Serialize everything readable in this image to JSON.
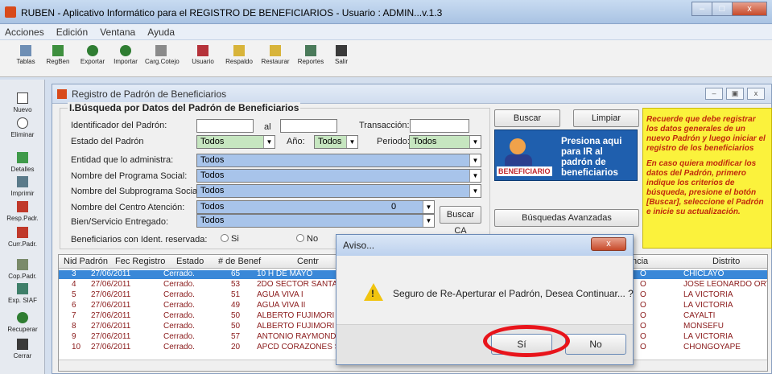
{
  "window": {
    "title": "RUBEN - Aplicativo Informático para el REGISTRO DE BENEFICIARIOS    - Usuario : ADMIN...v.1.3"
  },
  "menu": [
    "Acciones",
    "Edición",
    "Ventana",
    "Ayuda"
  ],
  "toolbar": [
    {
      "label": "Tablas",
      "icon": "table-icon"
    },
    {
      "label": "RegBen",
      "icon": "register-icon"
    },
    {
      "label": "Exportar",
      "icon": "export-icon"
    },
    {
      "label": "Importar",
      "icon": "import-icon"
    },
    {
      "label": "Carg.Cotejo",
      "icon": "compare-icon"
    },
    {
      "label": "Usuario",
      "icon": "user-icon"
    },
    {
      "label": "Respaldo",
      "icon": "backup-icon"
    },
    {
      "label": "Restaurar",
      "icon": "restore-icon"
    },
    {
      "label": "Reportes",
      "icon": "report-icon"
    },
    {
      "label": "Salir",
      "icon": "exit-icon"
    }
  ],
  "sidebar": [
    {
      "label": "Nuevo",
      "icon": "new-icon"
    },
    {
      "label": "Eliminar",
      "icon": "delete-icon"
    },
    {
      "label": "Detalles",
      "icon": "details-icon"
    },
    {
      "label": "Imprimir",
      "icon": "print-icon"
    },
    {
      "label": "Resp.Padr.",
      "icon": "arrow-left-icon"
    },
    {
      "label": "Curr.Padr.",
      "icon": "arrow-right-icon"
    },
    {
      "label": "Cop.Padr.",
      "icon": "copy-icon"
    },
    {
      "label": "Exp. SIAF",
      "icon": "export-siaf-icon"
    },
    {
      "label": "Recuperar",
      "icon": "recover-icon"
    },
    {
      "label": "Cerrar",
      "icon": "close-door-icon"
    }
  ],
  "child": {
    "title": "Registro de Padrón de Beneficiarios",
    "group_title": "I.Búsqueda por Datos del Padrón de Beneficiarios",
    "labels": {
      "id": "Identificador del Padrón:",
      "al": "al",
      "transaccion": "Transacción:",
      "estado": "Estado del Padrón",
      "anio": "Año:",
      "periodo": "Periodo:",
      "entidad": "Entidad que lo administra:",
      "programa": "Nombre del Programa Social:",
      "subprograma": "Nombre del Subprograma Social:",
      "centro": "Nombre del Centro Atención:",
      "bien": "Bien/Servicio Entregado:",
      "reservada": "Beneficiarios con Ident. reservada:"
    },
    "values": {
      "estado": "Todos",
      "anio": "Todos",
      "periodo": "Todos",
      "entidad": "Todos",
      "programa": "Todos",
      "subprograma": "Todos",
      "centro": "Todos",
      "centro_num": "0",
      "bien": "Todos"
    },
    "radios": {
      "si": "Si",
      "no": "No"
    },
    "buttons": {
      "buscar": "Buscar",
      "limpiar": "Limpiar",
      "buscar_ca": "Buscar CA",
      "avanzadas": "Búsquedas Avanzadas"
    },
    "benef": {
      "badge": "BENEFICIARIO",
      "message": "Presiona aqui para IR al padrón de beneficiarios"
    },
    "note": [
      "Recuerde que debe registrar los datos generales de un nuevo Padrón y luego iniciar el registro de los beneficiarios",
      "En caso quiera modificar los datos del Padrón, primero indique los criterios de búsqueda, presione el botón [Buscar], seleccione el Padrón e inicie su actualización."
    ]
  },
  "grid": {
    "columns": [
      "Nid Padrón",
      "Fec Registro",
      "Estado",
      "# de Benef",
      "Centr",
      "ncia",
      "Distrito"
    ],
    "rows": [
      {
        "nid": "3",
        "fecha": "27/06/2011",
        "estado": "Cerrado.",
        "benef": "65",
        "centro": "10 H DE MAYO",
        "prov": "O",
        "distrito": "CHICLAYO",
        "selected": true
      },
      {
        "nid": "4",
        "fecha": "27/06/2011",
        "estado": "Cerrado.",
        "benef": "53",
        "centro": "2DO SECTOR SANTA",
        "prov": "O",
        "distrito": "JOSE LEONARDO ORTI",
        "selected": false
      },
      {
        "nid": "5",
        "fecha": "27/06/2011",
        "estado": "Cerrado.",
        "benef": "51",
        "centro": "AGUA VIVA I",
        "prov": "O",
        "distrito": "LA VICTORIA",
        "selected": false
      },
      {
        "nid": "6",
        "fecha": "27/06/2011",
        "estado": "Cerrado.",
        "benef": "49",
        "centro": "AGUA VIVA II",
        "prov": "O",
        "distrito": "LA VICTORIA",
        "selected": false
      },
      {
        "nid": "7",
        "fecha": "27/06/2011",
        "estado": "Cerrado.",
        "benef": "50",
        "centro": "ALBERTO FUJIMORI",
        "prov": "O",
        "distrito": "CAYALTI",
        "selected": false
      },
      {
        "nid": "8",
        "fecha": "27/06/2011",
        "estado": "Cerrado.",
        "benef": "50",
        "centro": "ALBERTO FUJIMORI",
        "prov": "O",
        "distrito": "MONSEFU",
        "selected": false
      },
      {
        "nid": "9",
        "fecha": "27/06/2011",
        "estado": "Cerrado.",
        "benef": "57",
        "centro": "ANTONIO RAYMOND",
        "prov": "O",
        "distrito": "LA VICTORIA",
        "selected": false
      },
      {
        "nid": "10",
        "fecha": "27/06/2011",
        "estado": "Cerrado.",
        "benef": "20",
        "centro": "APCD CORAZONES S",
        "prov": "O",
        "distrito": "CHONGOYAPE",
        "selected": false
      }
    ]
  },
  "dialog": {
    "title": "Aviso...",
    "message": "Seguro de Re-Aperturar el Padrón, Desea Continuar... ?",
    "yes": "Sí",
    "no": "No",
    "close": "x"
  }
}
